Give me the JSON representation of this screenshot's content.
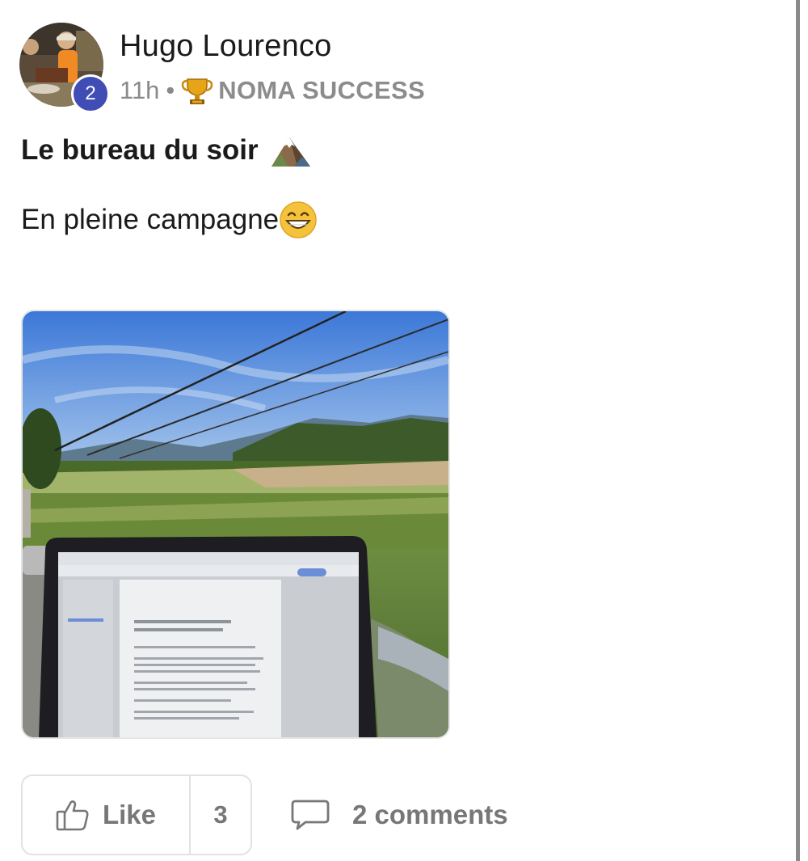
{
  "author": {
    "name": "Hugo Lourenco",
    "level": "2",
    "avatar_icon": "profile-photo"
  },
  "meta": {
    "time": "11h",
    "separator": "•",
    "category_icon": "trophy-icon",
    "category": "NOMA SUCCESS"
  },
  "post": {
    "title": "Le bureau du soir",
    "title_icon": "mountain-icon",
    "text": "En pleine campagne",
    "text_icon": "grinning-face-icon"
  },
  "actions": {
    "like_label": "Like",
    "like_count": "3",
    "comments_label": "2 comments"
  },
  "colors": {
    "level_badge": "#3f4db5",
    "muted_text": "#8a8a8a",
    "border": "#e2e2e2"
  }
}
